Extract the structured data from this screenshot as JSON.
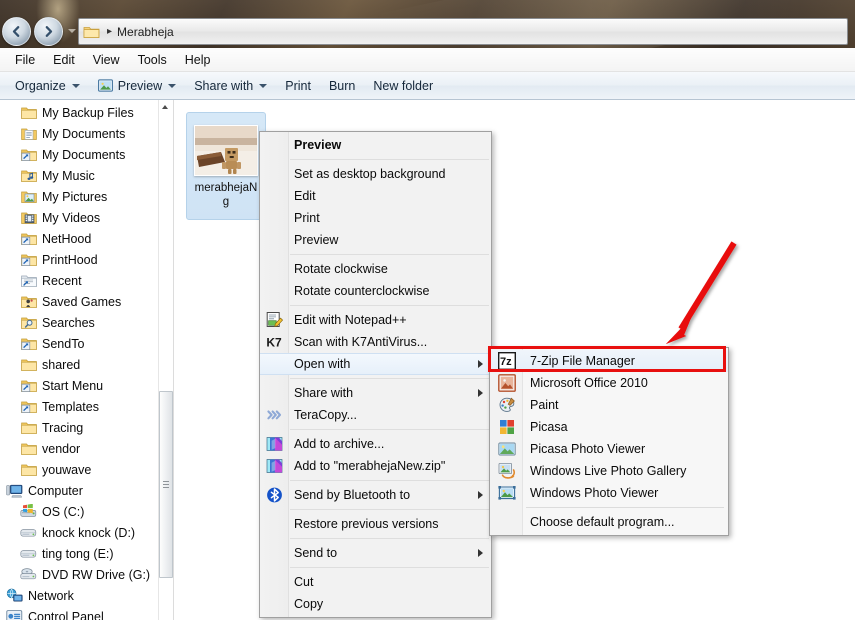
{
  "window": {
    "address_path": "Merabheja",
    "address_separator": "▸"
  },
  "menubar": {
    "items": [
      "File",
      "Edit",
      "View",
      "Tools",
      "Help"
    ]
  },
  "commandbar": {
    "items": [
      {
        "label": "Organize",
        "has_caret": true,
        "icon": ""
      },
      {
        "label": "Preview",
        "has_caret": true,
        "icon": "picture-icon"
      },
      {
        "label": "Share with",
        "has_caret": true,
        "icon": ""
      },
      {
        "label": "Print",
        "has_caret": false,
        "icon": ""
      },
      {
        "label": "Burn",
        "has_caret": false,
        "icon": ""
      },
      {
        "label": "New folder",
        "has_caret": false,
        "icon": ""
      }
    ]
  },
  "navigation_pane": {
    "items": [
      {
        "label": "My Backup Files",
        "icon": "folder-icon",
        "indent": 1
      },
      {
        "label": "My Documents",
        "icon": "folder-docs-icon",
        "indent": 1
      },
      {
        "label": "My Documents",
        "icon": "folder-shortcut-icon",
        "indent": 1
      },
      {
        "label": "My Music",
        "icon": "folder-music-icon",
        "indent": 1
      },
      {
        "label": "My Pictures",
        "icon": "folder-pictures-icon",
        "indent": 1
      },
      {
        "label": "My Videos",
        "icon": "folder-videos-icon",
        "indent": 1
      },
      {
        "label": "NetHood",
        "icon": "folder-shortcut-icon",
        "indent": 1
      },
      {
        "label": "PrintHood",
        "icon": "folder-shortcut-icon",
        "indent": 1
      },
      {
        "label": "Recent",
        "icon": "folder-recent-icon",
        "indent": 1
      },
      {
        "label": "Saved Games",
        "icon": "folder-games-icon",
        "indent": 1
      },
      {
        "label": "Searches",
        "icon": "folder-search-icon",
        "indent": 1
      },
      {
        "label": "SendTo",
        "icon": "folder-shortcut-icon",
        "indent": 1
      },
      {
        "label": "shared",
        "icon": "folder-icon",
        "indent": 1
      },
      {
        "label": "Start Menu",
        "icon": "folder-shortcut-icon",
        "indent": 1
      },
      {
        "label": "Templates",
        "icon": "folder-shortcut-icon",
        "indent": 1
      },
      {
        "label": "Tracing",
        "icon": "folder-icon",
        "indent": 1
      },
      {
        "label": "vendor",
        "icon": "folder-icon",
        "indent": 1
      },
      {
        "label": "youwave",
        "icon": "folder-icon",
        "indent": 1
      },
      {
        "label": "Computer",
        "icon": "computer-icon",
        "indent": 0
      },
      {
        "label": "OS (C:)",
        "icon": "hard-drive-windows-icon",
        "indent": 1
      },
      {
        "label": "knock knock (D:)",
        "icon": "hard-drive-icon",
        "indent": 1
      },
      {
        "label": "ting tong (E:)",
        "icon": "hard-drive-icon",
        "indent": 1
      },
      {
        "label": "DVD RW Drive (G:)",
        "icon": "dvd-drive-icon",
        "indent": 1
      },
      {
        "label": "Network",
        "icon": "network-icon",
        "indent": 0
      },
      {
        "label": "Control Panel",
        "icon": "control-panel-icon",
        "indent": 0
      }
    ]
  },
  "file_item": {
    "name": "merabhejaNew.jpg",
    "label_line1": "merabhejaN",
    "label_line2": "g",
    "selected": true
  },
  "context_menu": {
    "groups": [
      [
        {
          "label": "Set as desktop background",
          "bold": false,
          "icon": "",
          "submenu": false
        },
        {
          "label": "Edit",
          "bold": false,
          "icon": "",
          "submenu": false
        },
        {
          "label": "Print",
          "bold": false,
          "icon": "",
          "submenu": false
        },
        {
          "label": "Preview",
          "bold": false,
          "icon": "",
          "submenu": false
        }
      ],
      [
        {
          "label": "Rotate clockwise",
          "bold": false,
          "icon": "",
          "submenu": false
        },
        {
          "label": "Rotate counterclockwise",
          "bold": false,
          "icon": "",
          "submenu": false
        }
      ],
      [
        {
          "label": "Edit with Notepad++",
          "bold": false,
          "icon": "notepadpp-icon",
          "submenu": false
        },
        {
          "label": "Scan with K7AntiVirus...",
          "bold": false,
          "icon": "k7-antivirus-icon",
          "submenu": false
        },
        {
          "label": "Open with",
          "bold": false,
          "icon": "",
          "submenu": true,
          "highlighted": true
        }
      ],
      [
        {
          "label": "Share with",
          "bold": false,
          "icon": "",
          "submenu": true
        },
        {
          "label": "TeraCopy...",
          "bold": false,
          "icon": "teracopy-icon",
          "submenu": false
        }
      ],
      [
        {
          "label": "Add to archive...",
          "bold": false,
          "icon": "archive-icon",
          "submenu": false
        },
        {
          "label": "Add to \"merabhejaNew.zip\"",
          "bold": false,
          "icon": "archive-icon",
          "submenu": false
        }
      ],
      [
        {
          "label": "Send by Bluetooth to",
          "bold": false,
          "icon": "bluetooth-icon",
          "submenu": true
        }
      ],
      [
        {
          "label": "Restore previous versions",
          "bold": false,
          "icon": "",
          "submenu": false
        }
      ],
      [
        {
          "label": "Send to",
          "bold": false,
          "icon": "",
          "submenu": true
        }
      ],
      [
        {
          "label": "Cut",
          "bold": false,
          "icon": "",
          "submenu": false
        },
        {
          "label": "Copy",
          "bold": false,
          "icon": "",
          "submenu": false
        }
      ]
    ],
    "first_item": {
      "label": "Preview",
      "bold": true
    }
  },
  "open_with_submenu": {
    "items": [
      {
        "label": "7-Zip File Manager",
        "icon": "7zip-icon",
        "selected": true
      },
      {
        "label": "Microsoft Office 2010",
        "icon": "msoffice-icon",
        "selected": false
      },
      {
        "label": "Paint",
        "icon": "paint-icon",
        "selected": false
      },
      {
        "label": "Picasa",
        "icon": "picasa-icon",
        "selected": false
      },
      {
        "label": "Picasa Photo Viewer",
        "icon": "picasa-viewer-icon",
        "selected": false
      },
      {
        "label": "Windows Live Photo Gallery",
        "icon": "photo-gallery-icon",
        "selected": false
      },
      {
        "label": "Windows Photo Viewer",
        "icon": "photo-viewer-icon",
        "selected": false
      }
    ],
    "footer": {
      "label": "Choose default program...",
      "icon": ""
    }
  },
  "annotation": {
    "highlight_color": "#e8100f",
    "arrow_color": "#e8100f",
    "target": "7-Zip File Manager"
  }
}
